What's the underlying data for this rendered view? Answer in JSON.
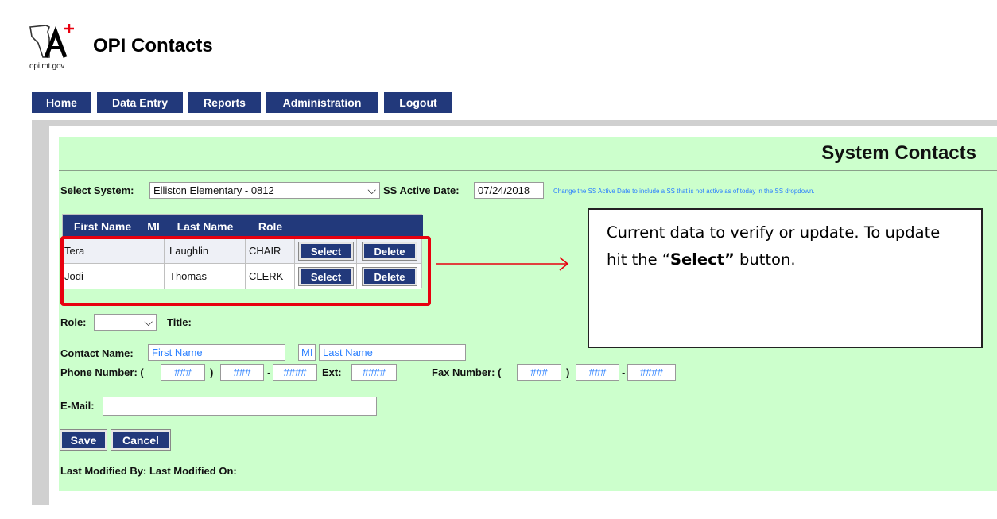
{
  "header": {
    "logo_url": "opi.mt.gov",
    "app_title": "OPI Contacts"
  },
  "nav": [
    {
      "label": "Home"
    },
    {
      "label": "Data Entry"
    },
    {
      "label": "Reports"
    },
    {
      "label": "Administration"
    },
    {
      "label": "Logout"
    }
  ],
  "page": {
    "title": "System Contacts"
  },
  "filters": {
    "system_label": "Select System:",
    "system_value": "Elliston Elementary - 0812",
    "active_date_label": "SS Active Date:",
    "active_date_value": "07/24/2018",
    "hint": "Change the SS Active Date to include a SS that is not active as of today in the SS dropdown."
  },
  "table": {
    "columns": [
      "First Name",
      "MI",
      "Last Name",
      "Role",
      "",
      ""
    ],
    "rows": [
      {
        "first": "Tera",
        "mi": "",
        "last": "Laughlin",
        "role": "CHAIR",
        "select": "Select",
        "delete": "Delete"
      },
      {
        "first": "Jodi",
        "mi": "",
        "last": "Thomas",
        "role": "CLERK",
        "select": "Select",
        "delete": "Delete"
      }
    ]
  },
  "form": {
    "role_label": "Role:",
    "role_value": "",
    "title_label": "Title:",
    "contact_name_label": "Contact Name:",
    "first_name_placeholder": "First Name",
    "mi_placeholder": "MI",
    "last_name_placeholder": "Last Name",
    "phone_label": "Phone Number: (",
    "paren_close": ")",
    "dash": "-",
    "area_placeholder": "###",
    "prefix_placeholder": "###",
    "line_placeholder": "####",
    "ext_label": "Ext:",
    "ext_placeholder": "####",
    "fax_label": "Fax Number: (",
    "fax_area_placeholder": "###",
    "fax_prefix_placeholder": "###",
    "fax_line_placeholder": "####",
    "email_label": "E-Mail:",
    "email_value": "",
    "save_label": "Save",
    "cancel_label": "Cancel",
    "last_modified": "Last Modified By: Last Modified On:"
  },
  "annotation": {
    "text_before": "Current data to verify or update. To update hit the “",
    "text_bold": "Select”",
    "text_after": " button.",
    "highlight_color": "#e8000f"
  },
  "colors": {
    "nav_bg": "#22397b",
    "panel_bg": "#ccffcc",
    "placeholder": "#2a7fff"
  }
}
